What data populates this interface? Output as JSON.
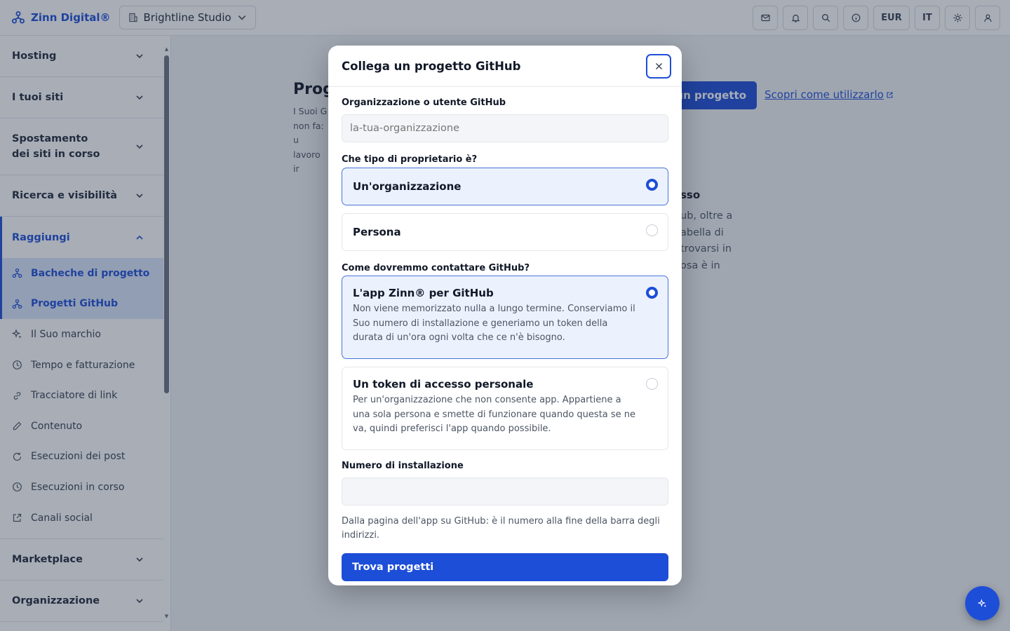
{
  "topbar": {
    "brand": "Zinn Digital®",
    "workspace": "Brightline Studio",
    "currency": "EUR",
    "language": "IT"
  },
  "sidebar": {
    "groups_top": [
      {
        "label": "Hosting"
      },
      {
        "label": "I tuoi siti"
      },
      {
        "label": "Spostamento dei siti in corso"
      },
      {
        "label": "Ricerca e visibilità"
      }
    ],
    "active_group": "Raggiungi",
    "items": [
      {
        "label": "Bacheche di progetto",
        "icon": "network-icon"
      },
      {
        "label": "Progetti GitHub",
        "icon": "network-icon"
      },
      {
        "label": "Il Suo marchio",
        "icon": "sparkle-icon"
      },
      {
        "label": "Tempo e fatturazione",
        "icon": "clock-icon"
      },
      {
        "label": "Tracciatore di link",
        "icon": "link-icon"
      },
      {
        "label": "Contenuto",
        "icon": "pencil-icon"
      },
      {
        "label": "Esecuzioni dei post",
        "icon": "refresh-icon"
      },
      {
        "label": "Esecuzioni in corso",
        "icon": "clock-icon"
      },
      {
        "label": "Canali social",
        "icon": "external-icon"
      }
    ],
    "groups_bottom": [
      {
        "label": "Marketplace"
      },
      {
        "label": "Organizzazione"
      }
    ]
  },
  "main": {
    "title": "Prog",
    "desc_line1": "I Suoi G",
    "desc_line2": "non fa: u",
    "desc_line3": "lavoro ir",
    "primary_button": "un progetto",
    "learn_link": "Scopri come utilizzarlo",
    "card_title": "sso",
    "card_text": "ub, oltre a\nabella di\ntrovarsi in\nosa è in"
  },
  "modal": {
    "title": "Collega un progetto GitHub",
    "org_label": "Organizzazione o utente GitHub",
    "org_placeholder": "la-tua-organizzazione",
    "owner_label": "Che tipo di proprietario è?",
    "owner_options": [
      {
        "title": "Un'organizzazione",
        "selected": true
      },
      {
        "title": "Persona",
        "selected": false
      }
    ],
    "contact_label": "Come dovremmo contattare GitHub?",
    "contact_options": [
      {
        "title": "L'app Zinn® per GitHub",
        "desc": "Non viene memorizzato nulla a lungo termine. Conserviamo il Suo numero di installazione e generiamo un token della durata di un'ora ogni volta che ce n'è bisogno.",
        "selected": true
      },
      {
        "title": "Un token di accesso personale",
        "desc": "Per un'organizzazione che non consente app. Appartiene a una sola persona e smette di funzionare quando questa se ne va, quindi preferisci l'app quando possibile.",
        "selected": false
      }
    ],
    "install_label": "Numero di installazione",
    "install_value": "",
    "install_hint": "Dalla pagina dell'app su GitHub: è il numero alla fine della barra degli indirizzi.",
    "submit_label": "Trova progetti"
  },
  "colors": {
    "accent": "#1d4ed8",
    "overlay": "#263248"
  }
}
